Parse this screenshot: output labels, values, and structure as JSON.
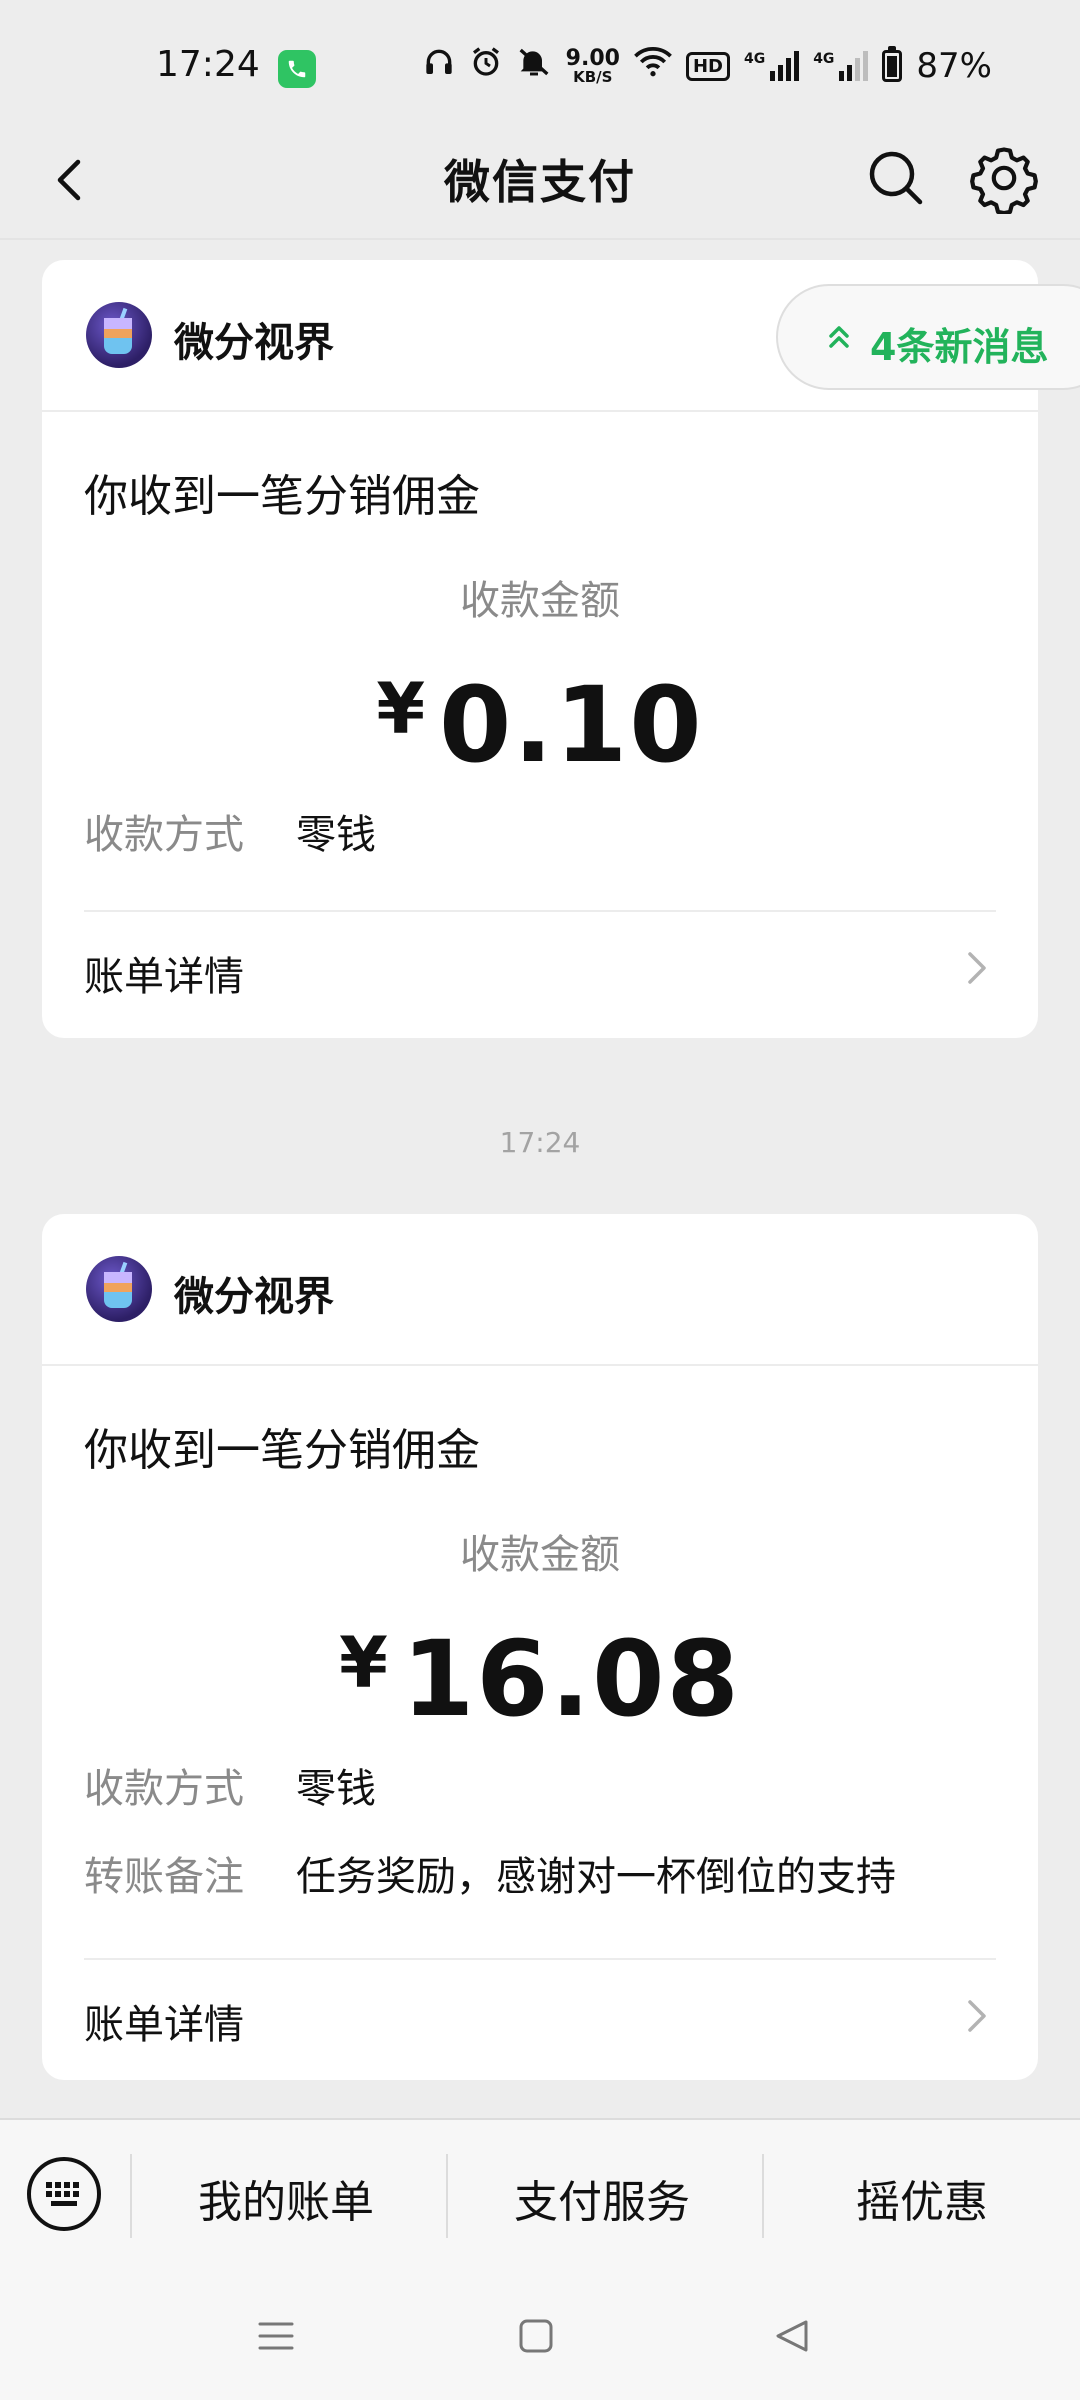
{
  "status_bar": {
    "time": "17:24",
    "speed_value": "9.00",
    "speed_unit": "KB/S",
    "hd_label": "HD",
    "network_1": "4G",
    "network_2": "4G",
    "battery_percent": "87%"
  },
  "header": {
    "title": "微信支付"
  },
  "new_messages_pill": "4条新消息",
  "cards": [
    {
      "merchant": "微分视界",
      "message_title": "你收到一笔分销佣金",
      "amount_label": "收款金额",
      "currency": "¥",
      "amount": "0.10",
      "method_label": "收款方式",
      "method_value": "零钱",
      "detail_label": "账单详情"
    },
    {
      "merchant": "微分视界",
      "message_title": "你收到一笔分销佣金",
      "amount_label": "收款金额",
      "currency": "¥",
      "amount": "16.08",
      "method_label": "收款方式",
      "method_value": "零钱",
      "remark_label": "转账备注",
      "remark_value": "任务奖励，感谢对一杯倒位的支持",
      "detail_label": "账单详情"
    }
  ],
  "timestamp": "17:24",
  "bottom_menu": {
    "items": [
      "我的账单",
      "支付服务",
      "摇优惠"
    ]
  },
  "colors": {
    "accent_green": "#22b35b",
    "background": "#ededed"
  }
}
